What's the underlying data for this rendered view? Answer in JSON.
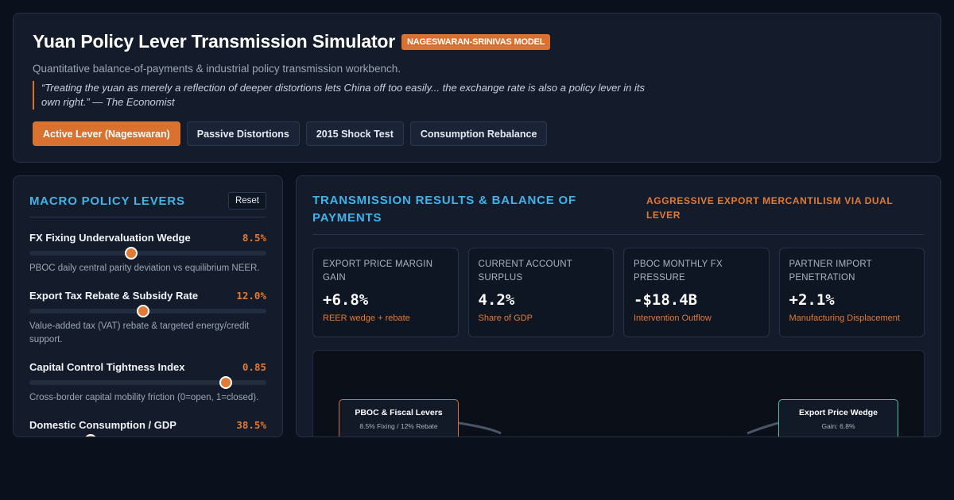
{
  "header": {
    "title": "Yuan Policy Lever Transmission Simulator",
    "badge": "NAGESWARAN-SRINIVAS MODEL",
    "subtitle": "Quantitative balance-of-payments & industrial policy transmission workbench.",
    "quote": "“Treating the yuan as merely a reflection of deeper distortions lets China off too easily... the exchange rate is also a policy lever in its own right.” — The Economist",
    "tabs": [
      {
        "label": "Active Lever (Nageswaran)",
        "active": true
      },
      {
        "label": "Passive Distortions",
        "active": false
      },
      {
        "label": "2015 Shock Test",
        "active": false
      },
      {
        "label": "Consumption Rebalance",
        "active": false
      }
    ]
  },
  "levers_panel": {
    "title": "MACRO POLICY LEVERS",
    "reset_label": "Reset",
    "levers": [
      {
        "label": "FX Fixing Undervaluation Wedge",
        "value": "8.5%",
        "level": 0.43,
        "desc": "PBOC daily central parity deviation vs equilibrium NEER."
      },
      {
        "label": "Export Tax Rebate & Subsidy Rate",
        "value": "12.0%",
        "level": 0.48,
        "desc": "Value-added tax (VAT) rebate & targeted energy/credit support."
      },
      {
        "label": "Capital Control Tightness Index",
        "value": "0.85",
        "level": 0.83,
        "desc": "Cross-border capital mobility friction (0=open, 1=closed)."
      },
      {
        "label": "Domestic Consumption / GDP",
        "value": "38.5%",
        "level": 0.26,
        "desc": ""
      }
    ]
  },
  "results_panel": {
    "title": "TRANSMISSION RESULTS & BALANCE OF PAYMENTS",
    "strategy": "AGGRESSIVE EXPORT MERCANTILISM VIA DUAL LEVER",
    "metrics": [
      {
        "label": "EXPORT PRICE MARGIN GAIN",
        "value": "+6.8%",
        "sub": "REER wedge + rebate"
      },
      {
        "label": "CURRENT ACCOUNT SURPLUS",
        "value": "4.2%",
        "sub": "Share of GDP"
      },
      {
        "label": "PBOC MONTHLY FX PRESSURE",
        "value": "-$18.4B",
        "sub": "Intervention Outflow"
      },
      {
        "label": "PARTNER IMPORT PENETRATION",
        "value": "+2.1%",
        "sub": "Manufacturing Displacement"
      }
    ],
    "flow": {
      "source": {
        "title": "PBOC & Fiscal Levers",
        "sub": "8.5% Fixing / 12% Rebate"
      },
      "target": {
        "title": "Export Price Wedge",
        "sub": "Gain: 6.8%"
      }
    }
  },
  "colors": {
    "accent": "#d97230",
    "heading": "#3fb3ea",
    "target_node": "#36c9a8",
    "background": "#0b111c"
  }
}
